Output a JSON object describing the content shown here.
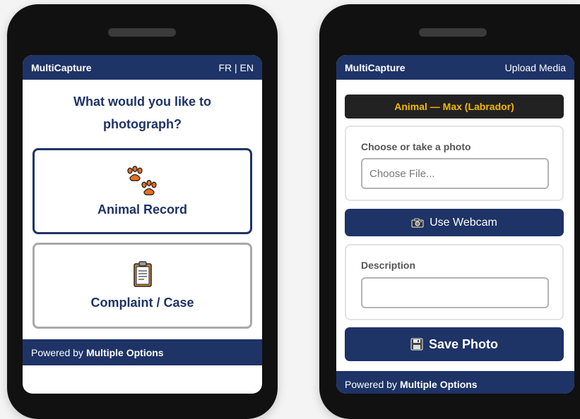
{
  "left_screen": {
    "header": {
      "brand": "MultiCapture",
      "lang": "FR | EN"
    },
    "question": "What would you like to photograph?",
    "choices": [
      {
        "label": "Animal Record",
        "icon": "paw-prints-icon"
      },
      {
        "label": "Complaint / Case",
        "icon": "clipboard-icon"
      }
    ],
    "footer": {
      "prefix": "Powered by",
      "brand": "Multiple Options"
    }
  },
  "right_screen": {
    "header": {
      "brand": "MultiCapture",
      "right": "Upload Media"
    },
    "subject_title": "Animal — Max (Labrador)",
    "file_card": {
      "label": "Choose or take a photo",
      "file_placeholder": "Choose File..."
    },
    "webcam_button": {
      "label": "Use Webcam",
      "icon": "camera-icon"
    },
    "description_card": {
      "label": "Description",
      "value": ""
    },
    "save_button": {
      "label": "Save Photo",
      "icon": "floppy-disk-icon"
    },
    "footer": {
      "prefix": "Powered by",
      "brand": "Multiple Options"
    }
  },
  "colors": {
    "navy": "#1e3366",
    "accent_yellow": "#f5b800",
    "paw_orange": "#e8701a"
  }
}
